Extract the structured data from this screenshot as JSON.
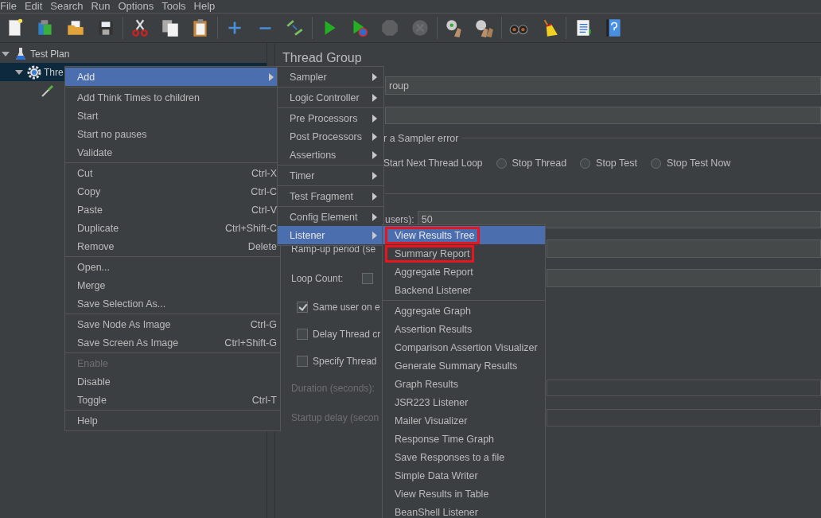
{
  "menubar": [
    "File",
    "Edit",
    "Search",
    "Run",
    "Options",
    "Tools",
    "Help"
  ],
  "toolbar": [
    [
      {
        "kind": "new",
        "disabled": false
      },
      {
        "kind": "templates",
        "disabled": false
      },
      {
        "kind": "open",
        "disabled": false
      },
      {
        "kind": "save",
        "disabled": false
      }
    ],
    [
      {
        "kind": "cut",
        "disabled": false
      },
      {
        "kind": "copy",
        "disabled": false
      },
      {
        "kind": "paste",
        "disabled": false
      }
    ],
    [
      {
        "kind": "add",
        "disabled": false
      },
      {
        "kind": "remove",
        "disabled": false
      },
      {
        "kind": "toggle",
        "disabled": false
      }
    ],
    [
      {
        "kind": "start",
        "disabled": false
      },
      {
        "kind": "start_no_pauses",
        "disabled": false
      },
      {
        "kind": "stop",
        "disabled": true
      },
      {
        "kind": "shutdown",
        "disabled": true
      }
    ],
    [
      {
        "kind": "clear",
        "disabled": false
      },
      {
        "kind": "clear_all",
        "disabled": false
      }
    ],
    [
      {
        "kind": "search",
        "disabled": false
      },
      {
        "kind": "reset_search",
        "disabled": false
      }
    ],
    [
      {
        "kind": "function_helper",
        "disabled": false
      },
      {
        "kind": "help",
        "disabled": false
      }
    ]
  ],
  "tree": [
    {
      "label": "Test Plan",
      "kind": "test_plan",
      "expanded": true,
      "selected": false,
      "children": [
        {
          "label": "Thre",
          "kind": "thread_group",
          "expanded": true,
          "selected": true,
          "children": [
            {
              "kind": "sampler",
              "selected": false
            }
          ]
        }
      ]
    }
  ],
  "panel": {
    "title": "Thread Group",
    "name_value": "roup",
    "on_error": {
      "legend": "r a Sampler error",
      "partial_option": "Start Next Thread Loop",
      "options": [
        {
          "label": "Stop Thread",
          "selected": false
        },
        {
          "label": "Stop Test",
          "selected": false
        },
        {
          "label": "Stop Test Now",
          "selected": false
        }
      ]
    },
    "threads": {
      "label": "users):",
      "value": "50"
    },
    "ramp_up": {
      "label": "Ramp-up period (se"
    },
    "loop_count": {
      "label": "Loop Count:",
      "checked": false
    },
    "checkboxes": [
      {
        "label": "Same user on e",
        "checked": true
      },
      {
        "label": "Delay Thread cr",
        "checked": false
      },
      {
        "label": "Specify Thread",
        "checked": false
      }
    ],
    "duration": {
      "label": "Duration (seconds):",
      "disabled": true
    },
    "startup_delay": {
      "label": "Startup delay (secon",
      "disabled": true
    }
  },
  "context_menu": {
    "groups": [
      [
        {
          "label": "Add",
          "submenu": true,
          "selected": true,
          "disabled": false
        }
      ],
      [
        {
          "label": "Add Think Times to children",
          "submenu": false,
          "selected": false,
          "disabled": false
        },
        {
          "label": "Start",
          "submenu": false,
          "selected": false,
          "disabled": false
        },
        {
          "label": "Start no pauses",
          "submenu": false,
          "selected": false,
          "disabled": false
        },
        {
          "label": "Validate",
          "submenu": false,
          "selected": false,
          "disabled": false
        }
      ],
      [
        {
          "label": "Cut",
          "shortcut": "Ctrl-X",
          "submenu": false,
          "selected": false,
          "disabled": false
        },
        {
          "label": "Copy",
          "shortcut": "Ctrl-C",
          "submenu": false,
          "selected": false,
          "disabled": false
        },
        {
          "label": "Paste",
          "shortcut": "Ctrl-V",
          "submenu": false,
          "selected": false,
          "disabled": false
        },
        {
          "label": "Duplicate",
          "shortcut": "Ctrl+Shift-C",
          "submenu": false,
          "selected": false,
          "disabled": false
        },
        {
          "label": "Remove",
          "shortcut": "Delete",
          "submenu": false,
          "selected": false,
          "disabled": false
        }
      ],
      [
        {
          "label": "Open...",
          "submenu": false,
          "selected": false,
          "disabled": false
        },
        {
          "label": "Merge",
          "submenu": false,
          "selected": false,
          "disabled": false
        },
        {
          "label": "Save Selection As...",
          "submenu": false,
          "selected": false,
          "disabled": false
        }
      ],
      [
        {
          "label": "Save Node As Image",
          "shortcut": "Ctrl-G",
          "submenu": false,
          "selected": false,
          "disabled": false
        },
        {
          "label": "Save Screen As Image",
          "shortcut": "Ctrl+Shift-G",
          "submenu": false,
          "selected": false,
          "disabled": false
        }
      ],
      [
        {
          "label": "Enable",
          "submenu": false,
          "selected": false,
          "disabled": true
        },
        {
          "label": "Disable",
          "submenu": false,
          "selected": false,
          "disabled": false
        },
        {
          "label": "Toggle",
          "shortcut": "Ctrl-T",
          "submenu": false,
          "selected": false,
          "disabled": false
        }
      ],
      [
        {
          "label": "Help",
          "submenu": false,
          "selected": false,
          "disabled": false
        }
      ]
    ]
  },
  "add_menu": {
    "groups": [
      [
        {
          "label": "Sampler",
          "submenu": true,
          "selected": false
        }
      ],
      [
        {
          "label": "Logic Controller",
          "submenu": true,
          "selected": false
        }
      ],
      [
        {
          "label": "Pre Processors",
          "submenu": true,
          "selected": false
        },
        {
          "label": "Post Processors",
          "submenu": true,
          "selected": false
        },
        {
          "label": "Assertions",
          "submenu": true,
          "selected": false
        }
      ],
      [
        {
          "label": "Timer",
          "submenu": true,
          "selected": false
        }
      ],
      [
        {
          "label": "Test Fragment",
          "submenu": true,
          "selected": false
        }
      ],
      [
        {
          "label": "Config Element",
          "submenu": true,
          "selected": false
        },
        {
          "label": "Listener",
          "submenu": true,
          "selected": true
        }
      ]
    ]
  },
  "listener_menu": {
    "groups": [
      [
        {
          "label": "View Results Tree",
          "selected": true,
          "highlighted": true
        },
        {
          "label": "Summary Report",
          "selected": false,
          "highlighted": true
        },
        {
          "label": "Aggregate Report",
          "selected": false,
          "highlighted": false
        },
        {
          "label": "Backend Listener",
          "selected": false,
          "highlighted": false
        }
      ],
      [
        {
          "label": "Aggregate Graph",
          "selected": false,
          "highlighted": false
        },
        {
          "label": "Assertion Results",
          "selected": false,
          "highlighted": false
        },
        {
          "label": "Comparison Assertion Visualizer",
          "selected": false,
          "highlighted": false
        },
        {
          "label": "Generate Summary Results",
          "selected": false,
          "highlighted": false
        },
        {
          "label": "Graph Results",
          "selected": false,
          "highlighted": false
        },
        {
          "label": "JSR223 Listener",
          "selected": false,
          "highlighted": false
        },
        {
          "label": "Mailer Visualizer",
          "selected": false,
          "highlighted": false
        },
        {
          "label": "Response Time Graph",
          "selected": false,
          "highlighted": false
        },
        {
          "label": "Save Responses to a file",
          "selected": false,
          "highlighted": false
        },
        {
          "label": "Simple Data Writer",
          "selected": false,
          "highlighted": false
        },
        {
          "label": "View Results in Table",
          "selected": false,
          "highlighted": false
        },
        {
          "label": "BeanShell Listener",
          "selected": false,
          "highlighted": false
        }
      ]
    ]
  }
}
